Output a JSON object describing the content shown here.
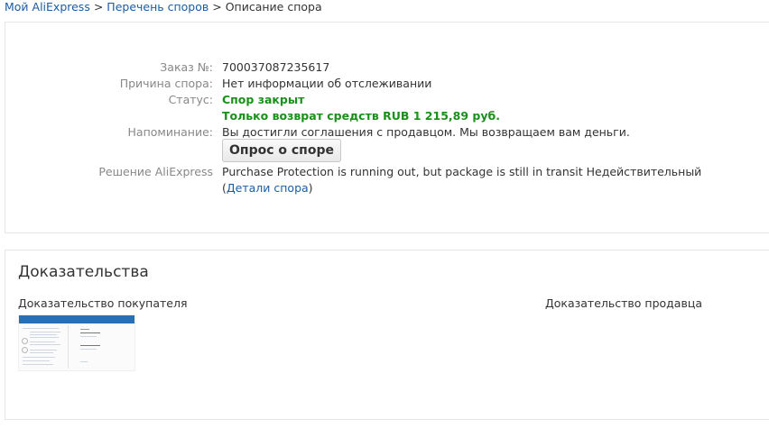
{
  "breadcrumb": {
    "items": [
      "Мой AliExpress",
      "Перечень споров"
    ],
    "separator": ">",
    "current": "Описание спора"
  },
  "dispute": {
    "order_label": "Заказ №:",
    "order_number": "700037087235617",
    "reason_label": "Причина спора:",
    "reason_value": "Нет информации об отслеживании",
    "status_label": "Статус:",
    "status_value": "Спор закрыт",
    "refund_text": "Только возврат средств RUB 1 215,89 руб.",
    "reminder_label": "Напоминание:",
    "reminder_value": "Вы достигли соглашения с продавцом. Мы возвращаем вам деньги.",
    "survey_button": "Опрос о споре",
    "decision_label": "Решение AliExpress",
    "decision_value": "Purchase Protection is running out, but package is still in transit  Недействительный",
    "details_open": "(",
    "details_link": "Детали спора",
    "details_close": ")"
  },
  "evidence": {
    "title": "Доказательства",
    "buyer_label": "Доказательство покупателя",
    "seller_label": "Доказательство продавца"
  },
  "colors": {
    "link": "#1a5ca5",
    "label": "#888888",
    "status_green": "#1a8f1a",
    "border": "#e6e6e6"
  }
}
